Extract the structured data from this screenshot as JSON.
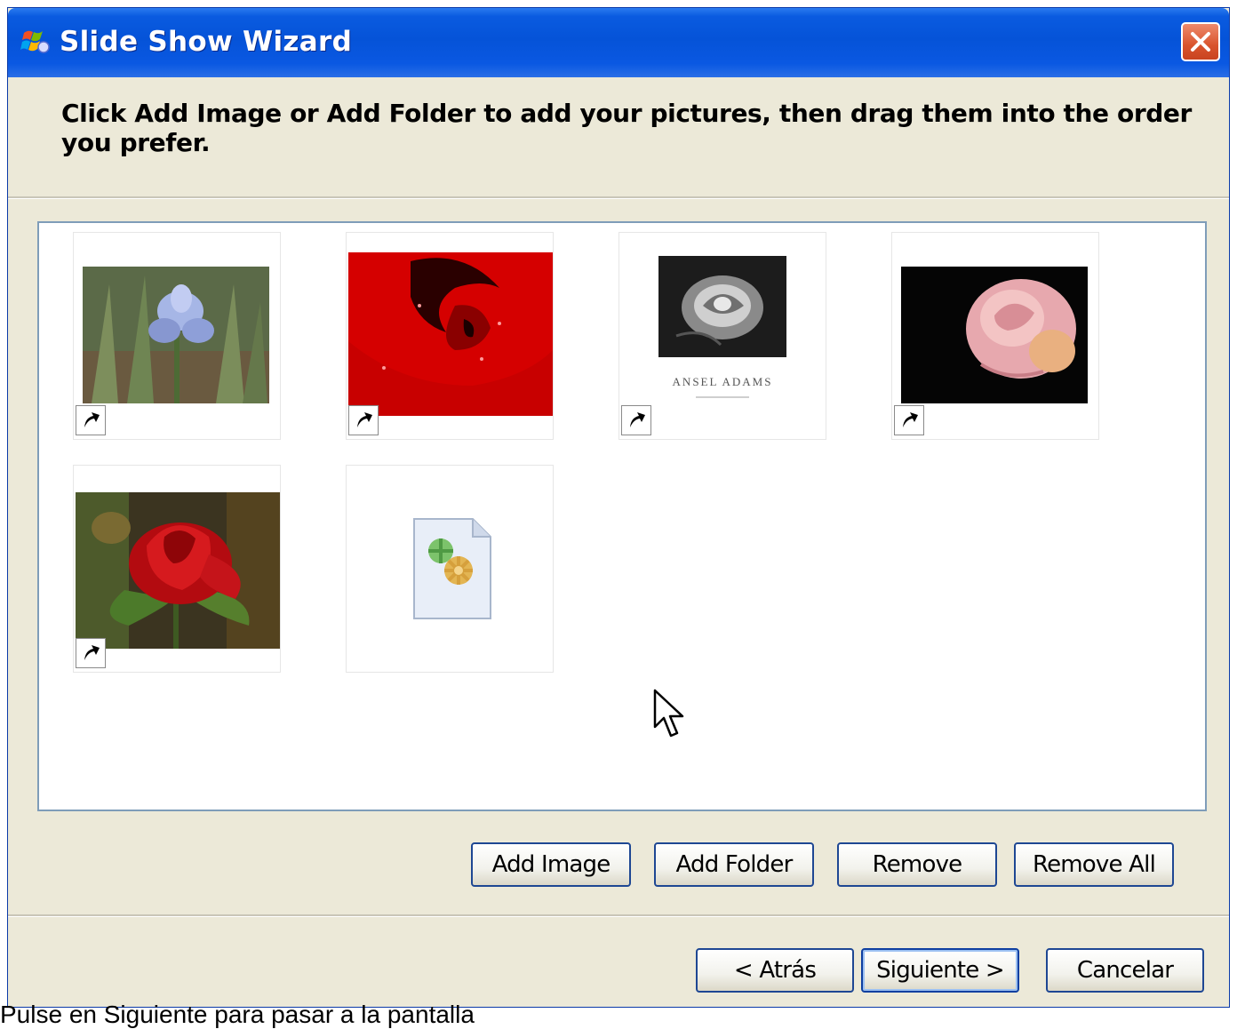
{
  "window": {
    "title": "Slide Show Wizard",
    "icon": "windows-media-icon"
  },
  "header": {
    "instruction": "Click Add Image or Add Folder to add your pictures, then drag them into the order you prefer."
  },
  "images": [
    {
      "name": "iris-photo",
      "shortcut": true
    },
    {
      "name": "red-rose-closeup-photo",
      "shortcut": true
    },
    {
      "name": "ansel-adams-rose-photo",
      "caption": "ANSEL ADAMS",
      "shortcut": true
    },
    {
      "name": "pink-rose-photo",
      "shortcut": true
    },
    {
      "name": "red-rose-garden-photo",
      "shortcut": true
    },
    {
      "name": "generic-file-icon",
      "shortcut": false
    }
  ],
  "actions": {
    "add_image": "Add Image",
    "add_folder": "Add Folder",
    "remove": "Remove",
    "remove_all": "Remove All"
  },
  "nav": {
    "back": "< Atrás",
    "next": "Siguiente >",
    "cancel": "Cancelar"
  },
  "status": {
    "text": "Pulse en Siguiente para pasar a la pantalla"
  },
  "colors": {
    "titlebar": "#0553d8",
    "dialog_bg": "#ece9d8",
    "button_border": "#1e4793"
  }
}
